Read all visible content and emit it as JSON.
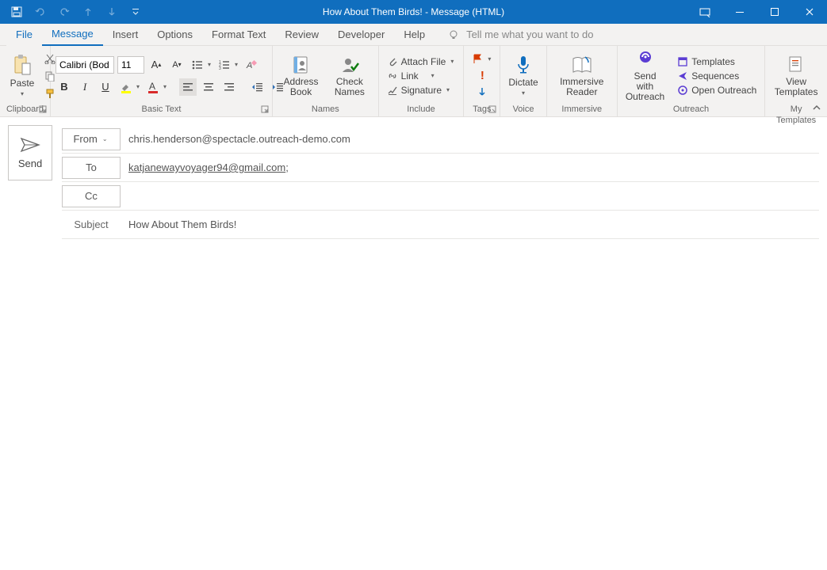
{
  "title": "How About Them Birds!  -  Message (HTML)",
  "tabs": {
    "file": "File",
    "message": "Message",
    "insert": "Insert",
    "options": "Options",
    "format_text": "Format Text",
    "review": "Review",
    "developer": "Developer",
    "help": "Help"
  },
  "tell_me_placeholder": "Tell me what you want to do",
  "ribbon": {
    "clipboard": {
      "label": "Clipboard",
      "paste": "Paste"
    },
    "basic_text": {
      "label": "Basic Text",
      "font_name": "Calibri (Bod",
      "font_size": "11"
    },
    "names": {
      "label": "Names",
      "address_book": "Address Book",
      "check_names": "Check Names"
    },
    "include": {
      "label": "Include",
      "attach_file": "Attach File",
      "link": "Link",
      "signature": "Signature"
    },
    "tags": {
      "label": "Tags"
    },
    "voice": {
      "label": "Voice",
      "dictate": "Dictate"
    },
    "immersive": {
      "label": "Immersive",
      "reader": "Immersive Reader"
    },
    "outreach": {
      "label": "Outreach",
      "send_with": "Send with Outreach",
      "templates": "Templates",
      "sequences": "Sequences",
      "open": "Open Outreach"
    },
    "my_templates": {
      "label": "My Templates",
      "view": "View Templates"
    }
  },
  "compose": {
    "send": "Send",
    "from_label": "From",
    "from_value": "chris.henderson@spectacle.outreach-demo.com",
    "to_label": "To",
    "to_value": "katjanewayvoyager94@gmail.com",
    "cc_label": "Cc",
    "cc_value": "",
    "subject_label": "Subject",
    "subject_value": "How About Them Birds!",
    "body": ""
  }
}
